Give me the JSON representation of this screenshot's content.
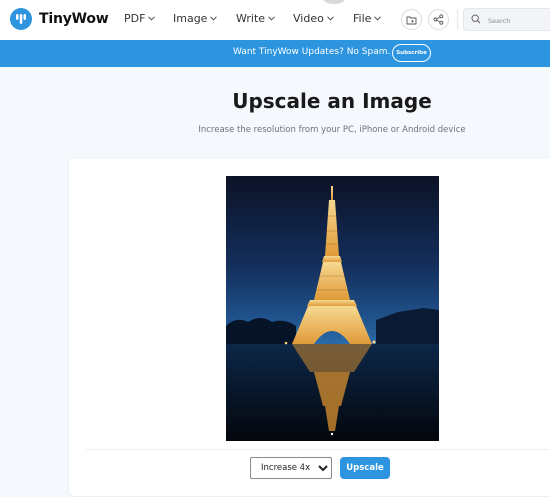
{
  "header": {
    "brand": "TinyWow",
    "nav": [
      {
        "label": "PDF"
      },
      {
        "label": "Image"
      },
      {
        "label": "Write"
      },
      {
        "label": "Video"
      },
      {
        "label": "File"
      }
    ],
    "search": {
      "placeholder": "Search"
    }
  },
  "banner": {
    "text": "Want TinyWow Updates? No Spam.",
    "subscribe_label": "Subscribe"
  },
  "main": {
    "title": "Upscale an Image",
    "subtitle": "Increase the resolution from your PC, iPhone or Android device"
  },
  "tool": {
    "scale_selected": "Increase 4x",
    "upscale_label": "Upscale"
  },
  "colors": {
    "accent": "#2d94e0",
    "background": "#f5f8fc"
  },
  "icons": [
    "tinywow-logo-icon",
    "chevron-down-icon",
    "folder-icon",
    "share-icon",
    "search-icon"
  ]
}
